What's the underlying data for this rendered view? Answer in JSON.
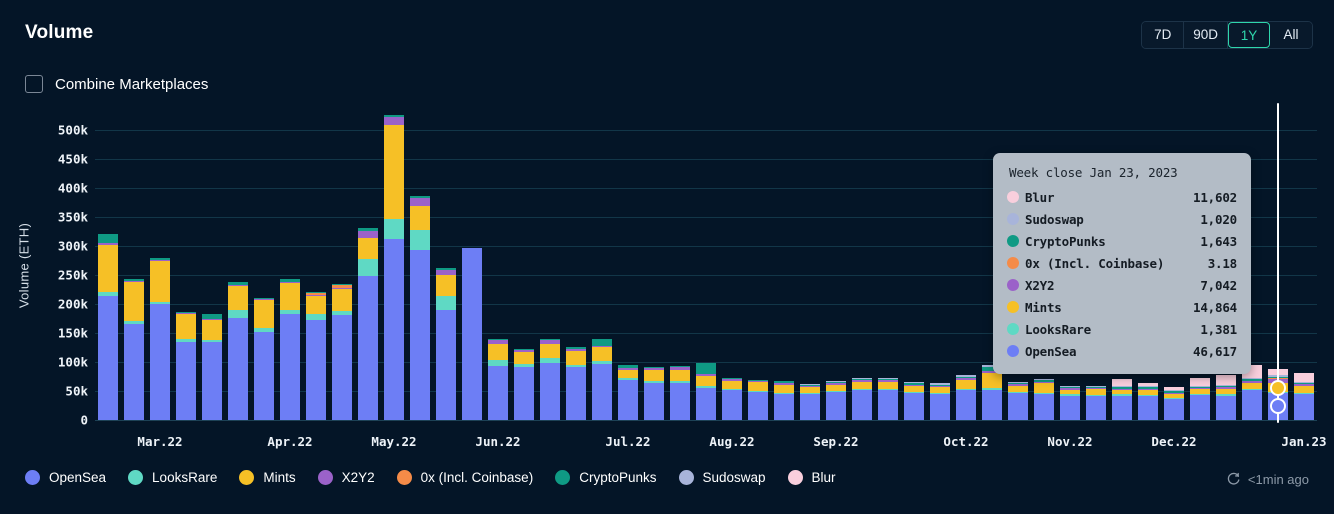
{
  "header": {
    "title": "Volume",
    "ranges": [
      {
        "label": "7D",
        "active": false
      },
      {
        "label": "90D",
        "active": false
      },
      {
        "label": "1Y",
        "active": true
      },
      {
        "label": "All",
        "active": false
      }
    ]
  },
  "combine": {
    "label": "Combine Marketplaces",
    "checked": false
  },
  "tooltip": {
    "title": "Week close Jan 23, 2023",
    "rows": [
      {
        "name": "Blur",
        "value": "11,602",
        "color": "#f9cfdd"
      },
      {
        "name": "Sudoswap",
        "value": "1,020",
        "color": "#a8b4da"
      },
      {
        "name": "CryptoPunks",
        "value": "1,643",
        "color": "#0f9a84"
      },
      {
        "name": "0x (Incl. Coinbase)",
        "value": "3.18",
        "color": "#f58b48"
      },
      {
        "name": "X2Y2",
        "value": "7,042",
        "color": "#9b62c9"
      },
      {
        "name": "Mints",
        "value": "14,864",
        "color": "#f6c026"
      },
      {
        "name": "LooksRare",
        "value": "1,381",
        "color": "#5fd9c4"
      },
      {
        "name": "OpenSea",
        "value": "46,617",
        "color": "#6d7ef5"
      }
    ]
  },
  "legend": [
    {
      "label": "OpenSea",
      "color": "#6d7ef5"
    },
    {
      "label": "LooksRare",
      "color": "#5fd9c4"
    },
    {
      "label": "Mints",
      "color": "#f6c026"
    },
    {
      "label": "X2Y2",
      "color": "#9b62c9"
    },
    {
      "label": "0x (Incl. Coinbase)",
      "color": "#f58b48"
    },
    {
      "label": "CryptoPunks",
      "color": "#0f9a84"
    },
    {
      "label": "Sudoswap",
      "color": "#a8b4da"
    },
    {
      "label": "Blur",
      "color": "#f9cfdd"
    }
  ],
  "refresh": {
    "label": "<1min ago",
    "icon": "refresh-clock-icon"
  },
  "chart_data": {
    "type": "bar",
    "stacked": true,
    "title": "Volume",
    "xlabel": "",
    "ylabel": "Volume (ETH)",
    "ylim": [
      0,
      520000
    ],
    "yticks": [
      0,
      50000,
      100000,
      150000,
      200000,
      250000,
      300000,
      350000,
      400000,
      450000,
      500000
    ],
    "ytick_labels": [
      "0",
      "50k",
      "100k",
      "150k",
      "200k",
      "250k",
      "300k",
      "350k",
      "400k",
      "450k",
      "500k"
    ],
    "grid": true,
    "legend_position": "bottom",
    "xtick_labels": [
      "Mar.22",
      "Apr.22",
      "May.22",
      "Jun.22",
      "Jul.22",
      "Aug.22",
      "Sep.22",
      "Oct.22",
      "Nov.22",
      "Dec.22",
      "Jan.23"
    ],
    "xtick_indices": [
      2,
      7,
      11,
      15,
      20,
      24,
      28,
      33,
      37,
      41,
      46
    ],
    "series_order": [
      "OpenSea",
      "LooksRare",
      "Mints",
      "X2Y2",
      "0x (Incl. Coinbase)",
      "CryptoPunks",
      "Sudoswap",
      "Blur"
    ],
    "series_colors": {
      "OpenSea": "#6d7ef5",
      "LooksRare": "#5fd9c4",
      "Mints": "#f6c026",
      "X2Y2": "#9b62c9",
      "0x (Incl. Coinbase)": "#f58b48",
      "CryptoPunks": "#0f9a84",
      "Sudoswap": "#a8b4da",
      "Blur": "#f9cfdd"
    },
    "bars": [
      {
        "OpenSea": 214000,
        "LooksRare": 6000,
        "Mints": 82000,
        "X2Y2": 2000,
        "0x (Incl. Coinbase)": 0,
        "CryptoPunks": 17000,
        "Sudoswap": 0,
        "Blur": 0
      },
      {
        "OpenSea": 166000,
        "LooksRare": 4000,
        "Mints": 68000,
        "X2Y2": 2000,
        "0x (Incl. Coinbase)": 0,
        "CryptoPunks": 3000,
        "Sudoswap": 0,
        "Blur": 0
      },
      {
        "OpenSea": 200000,
        "LooksRare": 4000,
        "Mints": 70000,
        "X2Y2": 2000,
        "0x (Incl. Coinbase)": 0,
        "CryptoPunks": 3000,
        "Sudoswap": 0,
        "Blur": 0
      },
      {
        "OpenSea": 135000,
        "LooksRare": 4000,
        "Mints": 43000,
        "X2Y2": 1000,
        "0x (Incl. Coinbase)": 0,
        "CryptoPunks": 2000,
        "Sudoswap": 0,
        "Blur": 0
      },
      {
        "OpenSea": 134000,
        "LooksRare": 4000,
        "Mints": 34000,
        "X2Y2": 1000,
        "0x (Incl. Coinbase)": 0,
        "CryptoPunks": 9000,
        "Sudoswap": 0,
        "Blur": 0
      },
      {
        "OpenSea": 176000,
        "LooksRare": 13000,
        "Mints": 42000,
        "X2Y2": 1000,
        "0x (Incl. Coinbase)": 0,
        "CryptoPunks": 4000,
        "Sudoswap": 0,
        "Blur": 0
      },
      {
        "OpenSea": 151000,
        "LooksRare": 8000,
        "Mints": 47000,
        "X2Y2": 1000,
        "0x (Incl. Coinbase)": 0,
        "CryptoPunks": 2000,
        "Sudoswap": 0,
        "Blur": 0
      },
      {
        "OpenSea": 182000,
        "LooksRare": 8000,
        "Mints": 46000,
        "X2Y2": 1000,
        "0x (Incl. Coinbase)": 0,
        "CryptoPunks": 5000,
        "Sudoswap": 0,
        "Blur": 0
      },
      {
        "OpenSea": 172000,
        "LooksRare": 10000,
        "Mints": 32000,
        "X2Y2": 2000,
        "0x (Incl. Coinbase)": 3000,
        "CryptoPunks": 2000,
        "Sudoswap": 0,
        "Blur": 0
      },
      {
        "OpenSea": 180000,
        "LooksRare": 8000,
        "Mints": 38000,
        "X2Y2": 2000,
        "0x (Incl. Coinbase)": 4000,
        "CryptoPunks": 3000,
        "Sudoswap": 0,
        "Blur": 0
      },
      {
        "OpenSea": 248000,
        "LooksRare": 30000,
        "Mints": 36000,
        "X2Y2": 12000,
        "0x (Incl. Coinbase)": 0,
        "CryptoPunks": 5000,
        "Sudoswap": 0,
        "Blur": 0
      },
      {
        "OpenSea": 312000,
        "LooksRare": 34000,
        "Mints": 162000,
        "X2Y2": 14000,
        "0x (Incl. Coinbase)": 0,
        "CryptoPunks": 4000,
        "Sudoswap": 0,
        "Blur": 0
      },
      {
        "OpenSea": 293000,
        "LooksRare": 35000,
        "Mints": 41000,
        "X2Y2": 13000,
        "0x (Incl. Coinbase)": 0,
        "CryptoPunks": 3000,
        "Sudoswap": 0,
        "Blur": 0
      },
      {
        "OpenSea": 190000,
        "LooksRare": 24000,
        "Mints": 35000,
        "X2Y2": 9000,
        "0x (Incl. Coinbase)": 0,
        "CryptoPunks": 3000,
        "Sudoswap": 0,
        "Blur": 0
      },
      {
        "OpenSea": 296000,
        "LooksRare": 0,
        "Mints": 0,
        "X2Y2": 0,
        "0x (Incl. Coinbase)": 0,
        "CryptoPunks": 0,
        "Sudoswap": 0,
        "Blur": 0
      },
      {
        "OpenSea": 93000,
        "LooksRare": 11000,
        "Mints": 27000,
        "X2Y2": 6000,
        "0x (Incl. Coinbase)": 0,
        "CryptoPunks": 2000,
        "Sudoswap": 0,
        "Blur": 0
      },
      {
        "OpenSea": 92000,
        "LooksRare": 5000,
        "Mints": 20000,
        "X2Y2": 3000,
        "0x (Incl. Coinbase)": 0,
        "CryptoPunks": 2000,
        "Sudoswap": 0,
        "Blur": 0
      },
      {
        "OpenSea": 98000,
        "LooksRare": 8000,
        "Mints": 25000,
        "X2Y2": 6000,
        "0x (Incl. Coinbase)": 0,
        "CryptoPunks": 2000,
        "Sudoswap": 0,
        "Blur": 0
      },
      {
        "OpenSea": 91000,
        "LooksRare": 4000,
        "Mints": 24000,
        "X2Y2": 4000,
        "0x (Incl. Coinbase)": 0,
        "CryptoPunks": 2000,
        "Sudoswap": 0,
        "Blur": 0
      },
      {
        "OpenSea": 96000,
        "LooksRare": 6000,
        "Mints": 23000,
        "X2Y2": 3000,
        "0x (Incl. Coinbase)": 0,
        "CryptoPunks": 12000,
        "Sudoswap": 0,
        "Blur": 0
      },
      {
        "OpenSea": 69000,
        "LooksRare": 3000,
        "Mints": 14000,
        "X2Y2": 3000,
        "0x (Incl. Coinbase)": 0,
        "CryptoPunks": 5000,
        "Sudoswap": 0,
        "Blur": 0
      },
      {
        "OpenSea": 64000,
        "LooksRare": 3000,
        "Mints": 20000,
        "X2Y2": 3000,
        "0x (Incl. Coinbase)": 0,
        "CryptoPunks": 2000,
        "Sudoswap": 0,
        "Blur": 0
      },
      {
        "OpenSea": 64000,
        "LooksRare": 4000,
        "Mints": 18000,
        "X2Y2": 5000,
        "0x (Incl. Coinbase)": 0,
        "CryptoPunks": 2000,
        "Sudoswap": 0,
        "Blur": 0
      },
      {
        "OpenSea": 55000,
        "LooksRare": 3000,
        "Mints": 17000,
        "X2Y2": 4000,
        "0x (Incl. Coinbase)": 0,
        "CryptoPunks": 19000,
        "Sudoswap": 0,
        "Blur": 0
      },
      {
        "OpenSea": 52000,
        "LooksRare": 2000,
        "Mints": 14000,
        "X2Y2": 2000,
        "0x (Incl. Coinbase)": 0,
        "CryptoPunks": 2000,
        "Sudoswap": 0,
        "Blur": 0
      },
      {
        "OpenSea": 48000,
        "LooksRare": 2000,
        "Mints": 15000,
        "X2Y2": 2000,
        "0x (Incl. Coinbase)": 0,
        "CryptoPunks": 2000,
        "Sudoswap": 0,
        "Blur": 0
      },
      {
        "OpenSea": 45000,
        "LooksRare": 2000,
        "Mints": 14000,
        "X2Y2": 2000,
        "0x (Incl. Coinbase)": 0,
        "CryptoPunks": 4000,
        "Sudoswap": 0,
        "Blur": 0
      },
      {
        "OpenSea": 45000,
        "LooksRare": 2000,
        "Mints": 9000,
        "X2Y2": 2000,
        "0x (Incl. Coinbase)": 0,
        "CryptoPunks": 2000,
        "Sudoswap": 2000,
        "Blur": 0
      },
      {
        "OpenSea": 48000,
        "LooksRare": 2000,
        "Mints": 11000,
        "X2Y2": 2000,
        "0x (Incl. Coinbase)": 0,
        "CryptoPunks": 2000,
        "Sudoswap": 2000,
        "Blur": 0
      },
      {
        "OpenSea": 52000,
        "LooksRare": 2000,
        "Mints": 12000,
        "X2Y2": 2000,
        "0x (Incl. Coinbase)": 0,
        "CryptoPunks": 2000,
        "Sudoswap": 3000,
        "Blur": 0
      },
      {
        "OpenSea": 51000,
        "LooksRare": 2000,
        "Mints": 13000,
        "X2Y2": 2000,
        "0x (Incl. Coinbase)": 0,
        "CryptoPunks": 2000,
        "Sudoswap": 3000,
        "Blur": 0
      },
      {
        "OpenSea": 47000,
        "LooksRare": 2000,
        "Mints": 10000,
        "X2Y2": 2000,
        "0x (Incl. Coinbase)": 0,
        "CryptoPunks": 2000,
        "Sudoswap": 2000,
        "Blur": 0
      },
      {
        "OpenSea": 44000,
        "LooksRare": 2000,
        "Mints": 11000,
        "X2Y2": 2000,
        "0x (Incl. Coinbase)": 0,
        "CryptoPunks": 2000,
        "Sudoswap": 3000,
        "Blur": 0
      },
      {
        "OpenSea": 51000,
        "LooksRare": 2000,
        "Mints": 16000,
        "X2Y2": 3000,
        "0x (Incl. Coinbase)": 0,
        "CryptoPunks": 2000,
        "Sudoswap": 3000,
        "Blur": 0
      },
      {
        "OpenSea": 52000,
        "LooksRare": 3000,
        "Mints": 26000,
        "X2Y2": 4000,
        "0x (Incl. Coinbase)": 0,
        "CryptoPunks": 7000,
        "Sudoswap": 2000,
        "Blur": 0
      },
      {
        "OpenSea": 47000,
        "LooksRare": 2000,
        "Mints": 10000,
        "X2Y2": 3000,
        "0x (Incl. Coinbase)": 0,
        "CryptoPunks": 2000,
        "Sudoswap": 2000,
        "Blur": 0
      },
      {
        "OpenSea": 44000,
        "LooksRare": 2000,
        "Mints": 18000,
        "X2Y2": 2000,
        "0x (Incl. Coinbase)": 0,
        "CryptoPunks": 2000,
        "Sudoswap": 2000,
        "Blur": 0
      },
      {
        "OpenSea": 42000,
        "LooksRare": 2000,
        "Mints": 8000,
        "X2Y2": 3000,
        "0x (Incl. Coinbase)": 0,
        "CryptoPunks": 2000,
        "Sudoswap": 2000,
        "Blur": 0
      },
      {
        "OpenSea": 41000,
        "LooksRare": 2000,
        "Mints": 10000,
        "X2Y2": 2000,
        "0x (Incl. Coinbase)": 0,
        "CryptoPunks": 2000,
        "Sudoswap": 2000,
        "Blur": 0
      },
      {
        "OpenSea": 42000,
        "LooksRare": 2000,
        "Mints": 8000,
        "X2Y2": 2000,
        "0x (Incl. Coinbase)": 0,
        "CryptoPunks": 2000,
        "Sudoswap": 2000,
        "Blur": 12000
      },
      {
        "OpenSea": 41000,
        "LooksRare": 2000,
        "Mints": 9000,
        "X2Y2": 2000,
        "0x (Incl. Coinbase)": 0,
        "CryptoPunks": 2000,
        "Sudoswap": 2000,
        "Blur": 6000
      },
      {
        "OpenSea": 36000,
        "LooksRare": 2000,
        "Mints": 7000,
        "X2Y2": 2000,
        "0x (Incl. Coinbase)": 0,
        "CryptoPunks": 2000,
        "Sudoswap": 2000,
        "Blur": 6000
      },
      {
        "OpenSea": 43000,
        "LooksRare": 2000,
        "Mints": 8000,
        "X2Y2": 2000,
        "0x (Incl. Coinbase)": 0,
        "CryptoPunks": 2000,
        "Sudoswap": 2000,
        "Blur": 13000
      },
      {
        "OpenSea": 42000,
        "LooksRare": 2000,
        "Mints": 9000,
        "X2Y2": 3000,
        "0x (Incl. Coinbase)": 0,
        "CryptoPunks": 2000,
        "Sudoswap": 2000,
        "Blur": 17000
      },
      {
        "OpenSea": 52000,
        "LooksRare": 2000,
        "Mints": 10000,
        "X2Y2": 4000,
        "0x (Incl. Coinbase)": 0,
        "CryptoPunks": 2000,
        "Sudoswap": 2000,
        "Blur": 22000
      },
      {
        "OpenSea": 46617,
        "LooksRare": 1381,
        "Mints": 14864,
        "X2Y2": 7042,
        "0x (Incl. Coinbase)": 3,
        "CryptoPunks": 1643,
        "Sudoswap": 1020,
        "Blur": 11602
      },
      {
        "OpenSea": 44000,
        "LooksRare": 2000,
        "Mints": 13000,
        "X2Y2": 3000,
        "0x (Incl. Coinbase)": 0,
        "CryptoPunks": 2000,
        "Sudoswap": 2000,
        "Blur": 14000
      }
    ],
    "cursor_bar_index": 45,
    "cursor_highlight_series": [
      "Mints",
      "OpenSea"
    ]
  }
}
